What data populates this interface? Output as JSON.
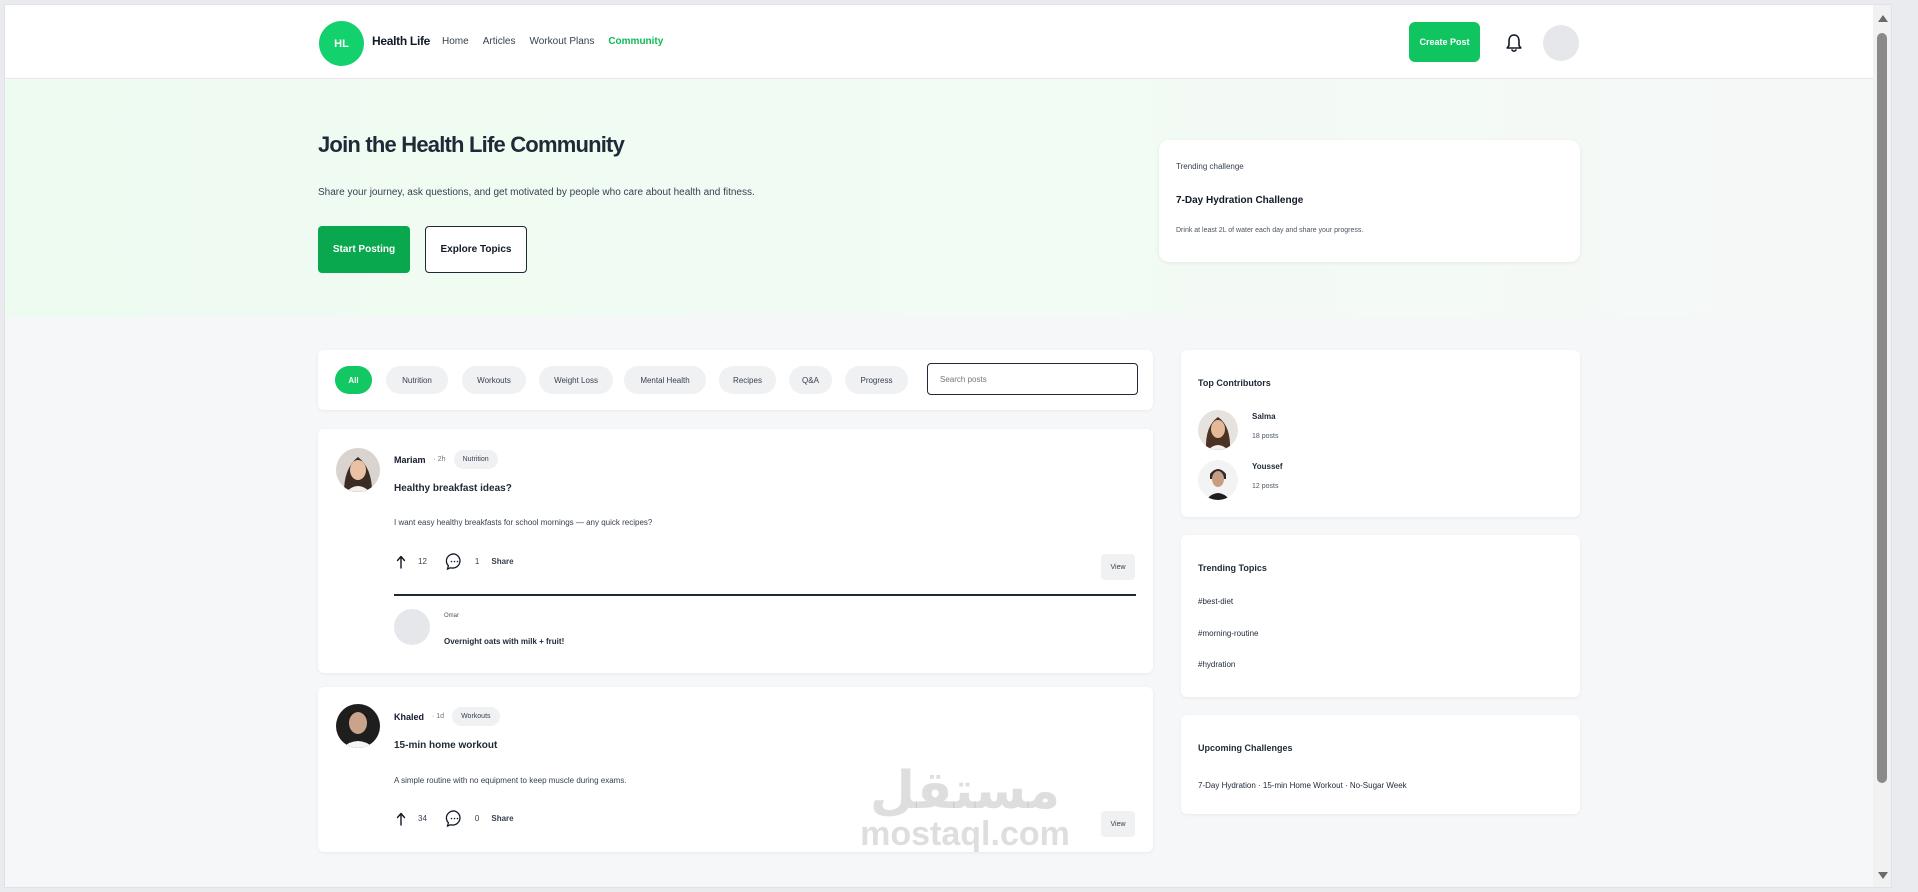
{
  "header": {
    "logo_text": "HL",
    "brand": "Health Life",
    "nav": [
      {
        "label": "Home"
      },
      {
        "label": "Articles"
      },
      {
        "label": "Workout Plans"
      },
      {
        "label": "Community",
        "active": true
      }
    ],
    "create_post": "Create Post",
    "accent_color": "#10c45f"
  },
  "hero": {
    "title": "Join the Health Life Community",
    "subtitle": "Share your journey, ask questions, and get motivated by people who care about health and fitness.",
    "primary_button": "Start Posting",
    "secondary_button": "Explore Topics",
    "challenge": {
      "eyebrow": "Trending challenge",
      "name": "7-Day Hydration Challenge",
      "description": "Drink at least 2L of water each day and share your progress."
    }
  },
  "filters": {
    "pills": [
      "All",
      "Nutrition",
      "Workouts",
      "Weight Loss",
      "Mental Health",
      "Recipes",
      "Q&A",
      "Progress"
    ],
    "active": "All",
    "search_placeholder": "Search posts"
  },
  "posts": [
    {
      "author": "Mariam",
      "time": "· 2h",
      "tag": "Nutrition",
      "title": "Healthy breakfast ideas?",
      "body": "I want easy healthy breakfasts for school mornings — any quick recipes?",
      "upvotes": "12",
      "comments": "1",
      "share": "Share",
      "view": "View",
      "reply": {
        "author": "Omar",
        "text": "Overnight oats with milk + fruit!"
      }
    },
    {
      "author": "Khaled",
      "time": "· 1d",
      "tag": "Workouts",
      "title": "15-min home workout",
      "body": "A simple routine with no equipment to keep muscle during exams.",
      "upvotes": "34",
      "comments": "0",
      "share": "Share",
      "view": "View"
    }
  ],
  "sidebar": {
    "contributors_title": "Top Contributors",
    "contributors": [
      {
        "name": "Salma",
        "posts": "18 posts"
      },
      {
        "name": "Youssef",
        "posts": "12 posts"
      }
    ],
    "topics_title": "Trending Topics",
    "topics": [
      "#best-diet",
      "#morning-routine",
      "#hydration"
    ],
    "upcoming_title": "Upcoming Challenges",
    "upcoming_text": "7-Day Hydration · 15-min Home Workout · No-Sugar Week"
  },
  "watermark": {
    "arabic": "مستقل",
    "latin": "mostaql.com"
  }
}
